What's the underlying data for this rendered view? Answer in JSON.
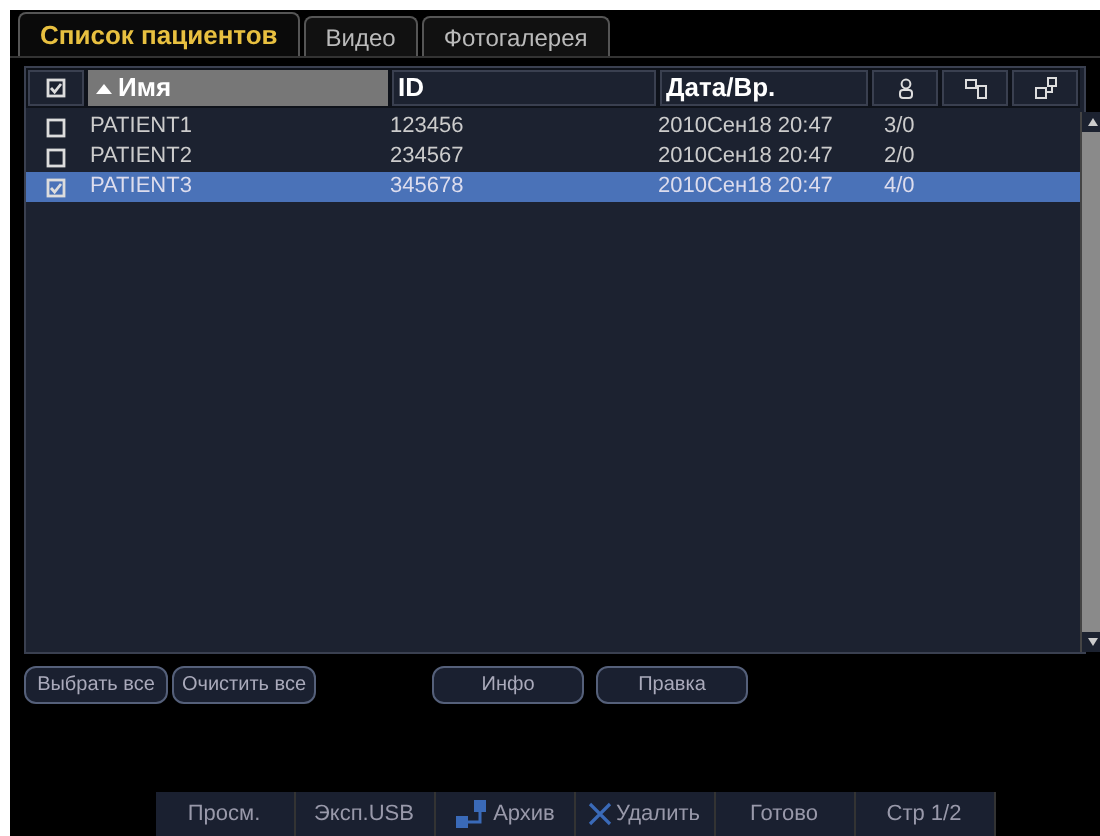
{
  "tabs": [
    {
      "label": "Список пациентов",
      "selected": true
    },
    {
      "label": "Видео",
      "selected": false
    },
    {
      "label": "Фотогалерея",
      "selected": false
    }
  ],
  "table": {
    "select_all_checked": true,
    "columns": [
      {
        "label": "Имя",
        "kind": "sorted"
      },
      {
        "label": "ID",
        "kind": "text"
      },
      {
        "label": "Дата/Вр.",
        "kind": "text"
      },
      {
        "kind": "person"
      },
      {
        "kind": "images"
      },
      {
        "kind": "archive"
      }
    ],
    "rows": [
      {
        "name": "PATIENT1",
        "id": "123456",
        "datetime": "2010Сен18 20:47",
        "count": "3/0",
        "checked": false,
        "selected": false
      },
      {
        "name": "PATIENT2",
        "id": "234567",
        "datetime": "2010Сен18 20:47",
        "count": "2/0",
        "checked": false,
        "selected": false
      },
      {
        "name": "PATIENT3",
        "id": "345678",
        "datetime": "2010Сен18 20:47",
        "count": "4/0",
        "checked": true,
        "selected": true
      }
    ]
  },
  "selection_buttons": [
    "Выбрать все",
    "Очистить все"
  ],
  "record_buttons": [
    "Инфо",
    "Правка"
  ],
  "bottom_bar": [
    {
      "label": "Просм.",
      "kind": "text"
    },
    {
      "label": "Эксп.USB",
      "kind": "text"
    },
    {
      "label": "Архив",
      "kind": "archive"
    },
    {
      "label": "Удалить",
      "kind": "delete"
    },
    {
      "label": "Готово",
      "kind": "text"
    },
    {
      "label": "Стр 1/2",
      "kind": "text"
    }
  ]
}
